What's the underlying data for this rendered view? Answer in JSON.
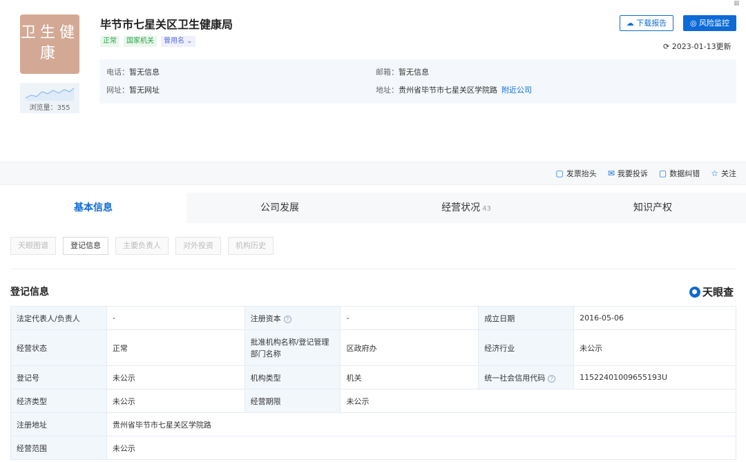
{
  "company": {
    "logo_text": "卫生健康",
    "name": "毕节市七星关区卫生健康局",
    "tags": [
      "正常",
      "国家机关",
      "曾用名 ⌄"
    ],
    "views_label": "浏览量：355",
    "phone_label": "电话：",
    "phone": "暂无信息",
    "email_label": "邮箱：",
    "email": "暂无信息",
    "website_label": "网址：",
    "website": "暂无网址",
    "address_label": "地址：",
    "address": "贵州省毕节市七星关区学院路",
    "nearby_link": "附近公司"
  },
  "header_actions": {
    "download": "下载报告",
    "monitor": "风险监控",
    "updated": "2023-01-13更新"
  },
  "toolbar": [
    "发票抬头",
    "我要投诉",
    "数据纠错",
    "关注"
  ],
  "tabs": [
    {
      "label": "基本信息",
      "count": ""
    },
    {
      "label": "公司发展",
      "count": ""
    },
    {
      "label": "经营状况",
      "count": "43"
    },
    {
      "label": "知识产权",
      "count": ""
    }
  ],
  "subtabs": [
    "天眼图谱",
    "登记信息",
    "主要负责人",
    "对外投资",
    "机构历史"
  ],
  "section_title": "登记信息",
  "brand": "天眼查",
  "registration": {
    "legal_rep_label": "法定代表人/负责人",
    "legal_rep": "-",
    "capital_label": "注册资本",
    "capital": "-",
    "founded_label": "成立日期",
    "founded": "2016-05-06",
    "status_label": "经营状态",
    "status": "正常",
    "approver_label": "批准机构名称/登记管理部门名称",
    "approver": "区政府办",
    "industry_label": "经济行业",
    "industry": "未公示",
    "reg_no_label": "登记号",
    "reg_no": "未公示",
    "org_type_label": "机构类型",
    "org_type": "机关",
    "credit_code_label": "统一社会信用代码",
    "credit_code": "11522401009655193U",
    "econ_type_label": "经济类型",
    "econ_type": "未公示",
    "term_label": "经营期限",
    "term": "未公示",
    "reg_address_label": "注册地址",
    "reg_address": "贵州省毕节市七星关区学院路",
    "scope_label": "经营范围",
    "scope": "未公示"
  }
}
